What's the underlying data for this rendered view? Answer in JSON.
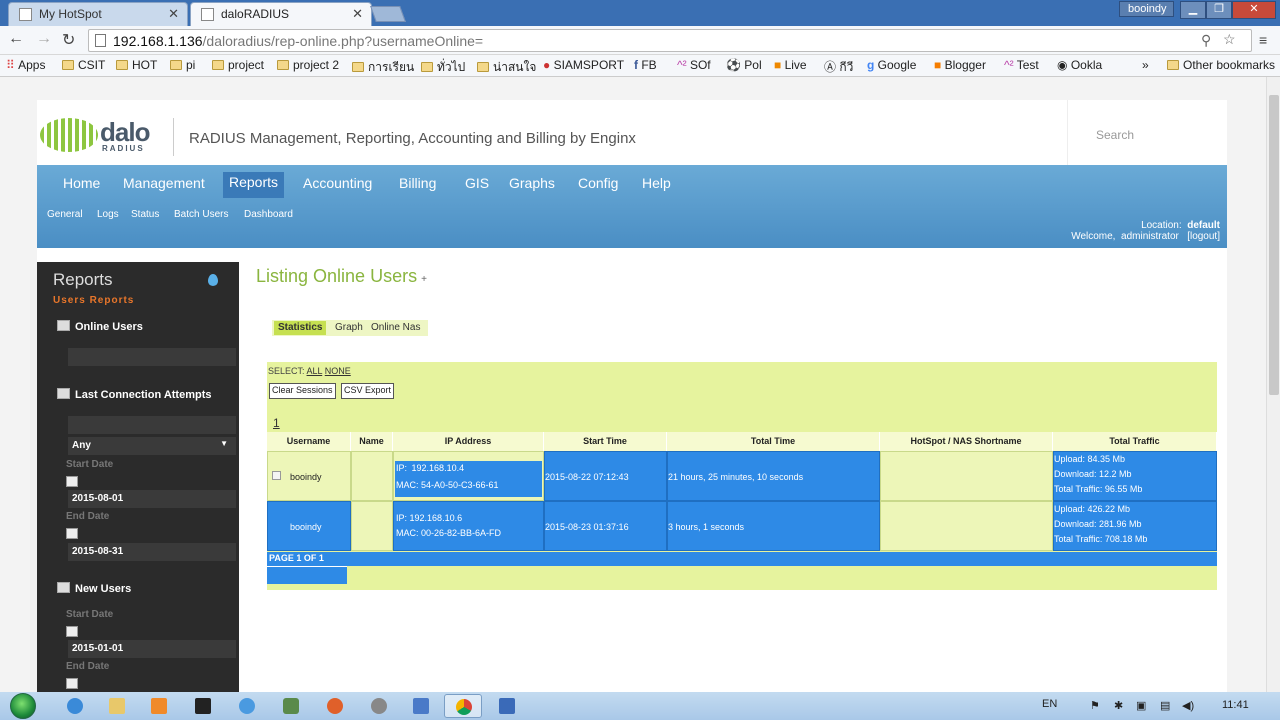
{
  "browser": {
    "tabs": [
      {
        "title": "My HotSpot",
        "active": false
      },
      {
        "title": "daloRADIUS",
        "active": true
      }
    ],
    "user_badge": "booindy",
    "url": {
      "host": "192.168.1.136",
      "path": "/daloradius/rep-online.php?usernameOnline="
    },
    "bookmarks": [
      "Apps",
      "CSIT",
      "HOT",
      "pi",
      "project",
      "project 2",
      "การเรียน",
      "ทั่วไป",
      "น่าสนใจ",
      "SIAMSPORT",
      "FB",
      "SOf",
      "Pol",
      "Live",
      "กีวี",
      "Google",
      "Blogger",
      "Test",
      "Ookla"
    ],
    "other_bookmarks": "Other bookmarks",
    "overflow": "»"
  },
  "header": {
    "logo_text": "dalo",
    "logo_sub": "RADIUS",
    "tagline": "RADIUS Management, Reporting, Accounting and Billing by Enginx",
    "search_placeholder": "Search"
  },
  "main_nav": [
    "Home",
    "Management",
    "Reports",
    "Accounting",
    "Billing",
    "GIS",
    "Graphs",
    "Config",
    "Help"
  ],
  "main_nav_active": "Reports",
  "sub_nav": [
    "General",
    "Logs",
    "Status",
    "Batch Users",
    "Dashboard"
  ],
  "location": {
    "label": "Location:",
    "value": "default",
    "welcome": "Welcome,",
    "user": "administrator",
    "logout": "[logout]"
  },
  "sidebar": {
    "heading": "Reports",
    "section": "Users Reports",
    "online_users": "Online Users",
    "last_connection": "Last Connection Attempts",
    "any": "Any",
    "start_date_label": "Start Date",
    "start_date": "2015-08-01",
    "end_date_label": "End Date",
    "end_date": "2015-08-31",
    "new_users": "New Users",
    "new_start_label": "Start Date",
    "new_start": "2015-01-01",
    "new_end_label": "End Date"
  },
  "content": {
    "title": "Listing Online Users",
    "title_plus": "+",
    "tabs": [
      "Statistics",
      "Graph",
      "Online Nas"
    ],
    "select_label": "SELECT:",
    "select_all": "ALL",
    "select_none": "NONE",
    "clear_sessions": "Clear Sessions",
    "csv_export": "CSV Export",
    "page_link": "1",
    "columns": [
      "Username",
      "Name",
      "IP Address",
      "Start Time",
      "Total Time",
      "HotSpot / NAS Shortname",
      "Total Traffic"
    ],
    "rows": [
      {
        "username": "booindy",
        "name": "",
        "ip_label": "IP:",
        "ip": "192.168.10.4",
        "mac_label": "MAC:",
        "mac": "54-A0-50-C3-66-61",
        "start": "2015-08-22 07:12:43",
        "total_time": "21 hours, 25 minutes, 10 seconds",
        "nas": "",
        "upload": "Upload: 84.35 Mb",
        "download": "Download: 12.2 Mb",
        "traffic": "Total Traffic: 96.55 Mb"
      },
      {
        "username": "booindy",
        "name": "",
        "ip_label": "IP:",
        "ip": "192.168.10.6",
        "mac_label": "MAC:",
        "mac": "00-26-82-BB-6A-FD",
        "start": "2015-08-23 01:37:16",
        "total_time": "3 hours, 1 seconds",
        "nas": "",
        "upload": "Upload: 426.22 Mb",
        "download": "Download: 281.96 Mb",
        "traffic": "Total Traffic: 708.18 Mb"
      }
    ],
    "page_info": "PAGE 1 OF 1"
  },
  "taskbar": {
    "lang": "EN",
    "time": "11:41"
  }
}
